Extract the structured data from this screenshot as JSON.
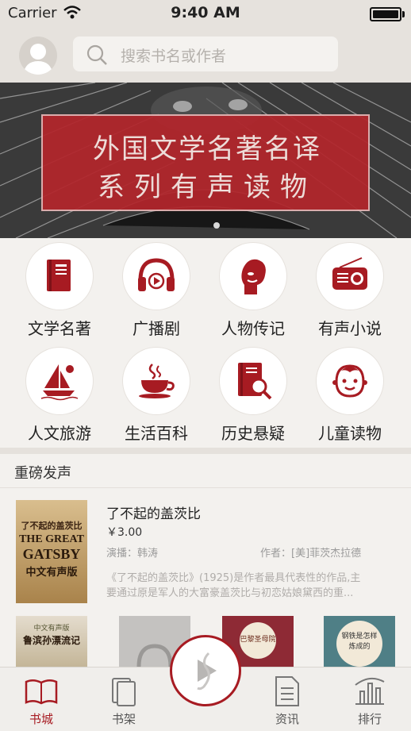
{
  "status_bar": {
    "carrier": "Carrier",
    "time": "9:40 AM"
  },
  "search": {
    "placeholder": "搜索书名或作者"
  },
  "banner": {
    "line1": "外国文学名著名译",
    "line2": "系列有声读物"
  },
  "categories": [
    {
      "label": "文学名著",
      "icon": "book-icon"
    },
    {
      "label": "广播剧",
      "icon": "headphones-icon"
    },
    {
      "label": "人物传记",
      "icon": "portrait-icon"
    },
    {
      "label": "有声小说",
      "icon": "radio-icon"
    },
    {
      "label": "人文旅游",
      "icon": "sailboat-icon"
    },
    {
      "label": "生活百科",
      "icon": "coffee-cup-icon"
    },
    {
      "label": "历史悬疑",
      "icon": "magnifier-book-icon"
    },
    {
      "label": "儿童读物",
      "icon": "child-face-icon"
    }
  ],
  "featured": {
    "title": "重磅发声",
    "book": {
      "title": "了不起的盖茨比",
      "price": "￥3.00",
      "narrator": "演播：韩涛",
      "author": "作者：[美]菲茨杰拉德",
      "description_line1": "《了不起的盖茨比》(1925)是作者最具代表性的作品,主",
      "description_line2": "要通过原是军人的大富豪盖茨比与初恋姑娘黛西的重...",
      "cover": {
        "line1": "了不起的盖茨比",
        "line2": "THE GREAT",
        "line3": "GATSBY",
        "line4": "中文有声版"
      }
    },
    "shelf_covers": [
      {
        "line1": "中文有声版",
        "line2": "鲁滨孙漂流记"
      },
      {
        "line1": ""
      },
      {
        "line1": "巴黎圣母院"
      },
      {
        "line1": "钢铁是怎样",
        "line2": "炼成的"
      }
    ]
  },
  "tabbar": {
    "tabs": [
      {
        "label": "书城",
        "icon": "open-book-icon",
        "active": true
      },
      {
        "label": "书架",
        "icon": "bookshelf-icon",
        "active": false
      },
      {
        "label": "资讯",
        "icon": "news-document-icon",
        "active": false
      },
      {
        "label": "排行",
        "icon": "bar-chart-icon",
        "active": false
      }
    ]
  },
  "colors": {
    "accent": "#a71b22",
    "banner_red": "#b3262c",
    "background": "#f3f1ee"
  }
}
